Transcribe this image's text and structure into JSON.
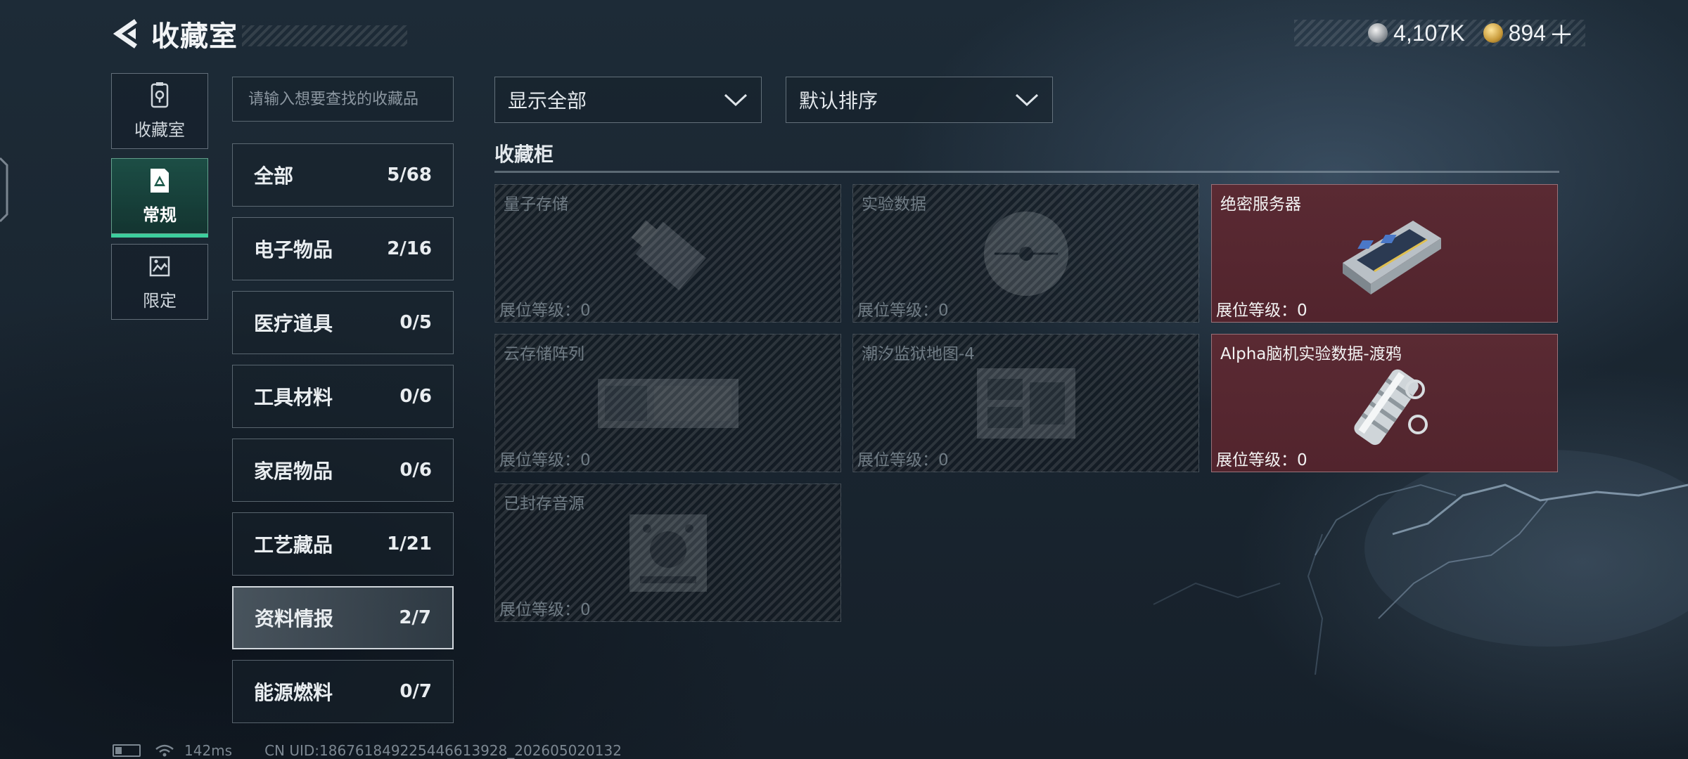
{
  "header": {
    "title": "收藏室"
  },
  "currency": [
    {
      "icon": "silver-coin-icon",
      "amount": "4,107K"
    },
    {
      "icon": "gold-coin-icon",
      "amount": "894"
    }
  ],
  "side_tabs": [
    {
      "label": "收藏室",
      "icon": "collection-room-icon",
      "active": false
    },
    {
      "label": "常规",
      "icon": "regular-icon",
      "active": true
    },
    {
      "label": "限定",
      "icon": "limited-icon",
      "active": false
    }
  ],
  "search": {
    "placeholder": "请输入想要查找的收藏品"
  },
  "categories": [
    {
      "name": "全部",
      "count": "5/68",
      "active": false
    },
    {
      "name": "电子物品",
      "count": "2/16",
      "active": false
    },
    {
      "name": "医疗道具",
      "count": "0/5",
      "active": false
    },
    {
      "name": "工具材料",
      "count": "0/6",
      "active": false
    },
    {
      "name": "家居物品",
      "count": "0/6",
      "active": false
    },
    {
      "name": "工艺藏品",
      "count": "1/21",
      "active": false
    },
    {
      "name": "资料情报",
      "count": "2/7",
      "active": true
    },
    {
      "name": "能源燃料",
      "count": "0/7",
      "active": false
    }
  ],
  "filters": {
    "display": "显示全部",
    "sort": "默认排序"
  },
  "section": {
    "title": "收藏柜"
  },
  "items": [
    {
      "name": "量子存储",
      "level": "展位等级：0",
      "owned": false,
      "icon": "usb-drive-icon"
    },
    {
      "name": "实验数据",
      "level": "展位等级：0",
      "owned": false,
      "icon": "disc-icon"
    },
    {
      "name": "绝密服务器",
      "level": "展位等级：0",
      "owned": true,
      "icon": "server-icon"
    },
    {
      "name": "云存储阵列",
      "level": "展位等级：0",
      "owned": false,
      "icon": "storage-array-icon"
    },
    {
      "name": "潮汐监狱地图-4",
      "level": "展位等级：0",
      "owned": false,
      "icon": "map-board-icon"
    },
    {
      "name": "Alpha脑机实验数据-渡鸦",
      "level": "展位等级：0",
      "owned": true,
      "icon": "data-capsule-icon"
    },
    {
      "name": "已封存音源",
      "level": "展位等级：0",
      "owned": false,
      "icon": "audio-device-icon"
    }
  ],
  "footer": {
    "ping": "142ms",
    "uid": "CN UID:186761849225446613928_202605020132"
  },
  "colors": {
    "accent": "#3ccf9d",
    "owned_card": "#5a2a33",
    "background": "#1a2631"
  }
}
